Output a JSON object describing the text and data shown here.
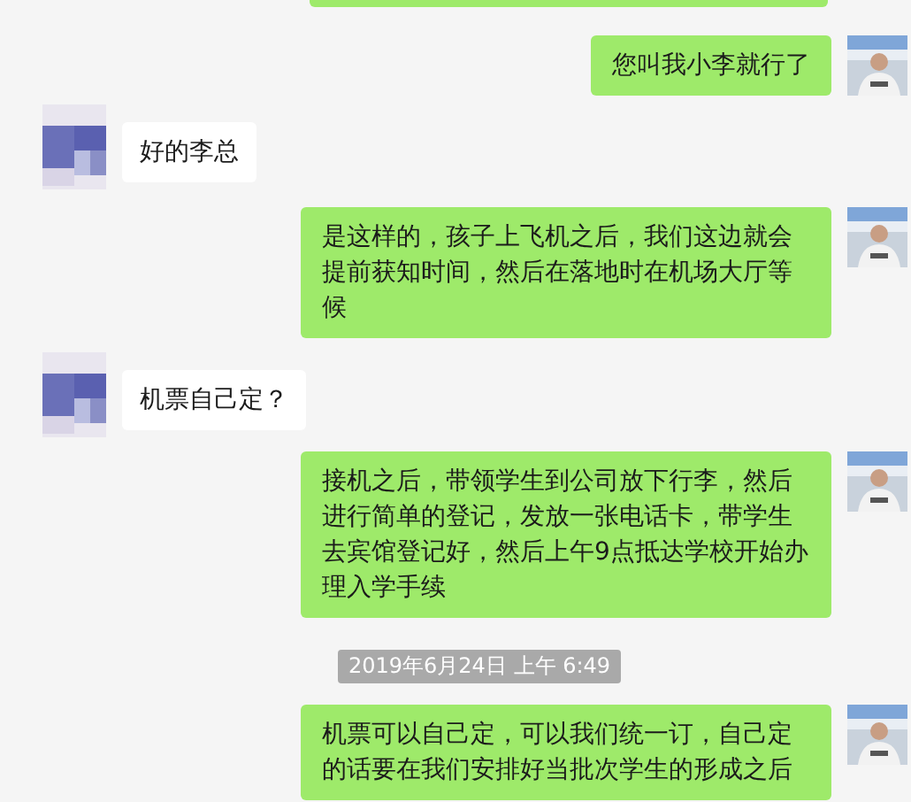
{
  "messages": [
    {
      "kind": "partial",
      "outgoing": true
    },
    {
      "kind": "text",
      "outgoing": true,
      "text": "您叫我小李就行了"
    },
    {
      "kind": "text",
      "outgoing": false,
      "text": "好的李总"
    },
    {
      "kind": "text",
      "outgoing": true,
      "text": "是这样的，孩子上飞机之后，我们这边就会提前获知时间，然后在落地时在机场大厅等候"
    },
    {
      "kind": "text",
      "outgoing": false,
      "text": "机票自己定？"
    },
    {
      "kind": "text",
      "outgoing": true,
      "text": "接机之后，带领学生到公司放下行李，然后进行简单的登记，发放一张电话卡，带学生去宾馆登记好，然后上午9点抵达学校开始办理入学手续"
    },
    {
      "kind": "time",
      "text": "2019年6月24日 上午 6:49"
    },
    {
      "kind": "text",
      "outgoing": true,
      "text": "机票可以自己定，可以我们统一订，自己定的话要在我们安排好当批次学生的形成之后"
    }
  ]
}
